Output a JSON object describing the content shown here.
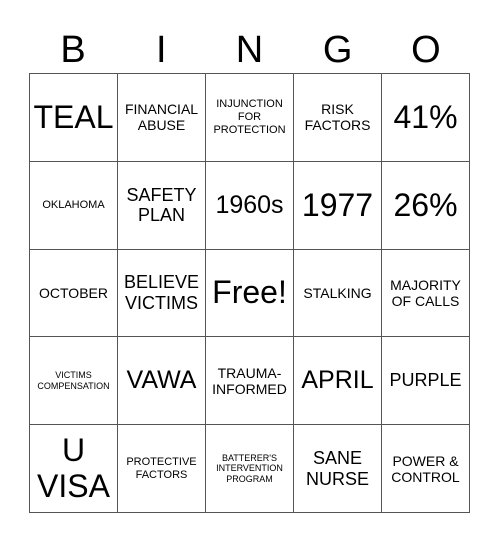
{
  "header": [
    "B",
    "I",
    "N",
    "G",
    "O"
  ],
  "cells": [
    [
      {
        "text": "TEAL",
        "size": "xl"
      },
      {
        "text": "FINANCIAL ABUSE",
        "size": "sm"
      },
      {
        "text": "INJUNCTION FOR PROTECTION",
        "size": "xs"
      },
      {
        "text": "RISK FACTORS",
        "size": "sm"
      },
      {
        "text": "41%",
        "size": "xl"
      }
    ],
    [
      {
        "text": "OKLAHOMA",
        "size": "xs"
      },
      {
        "text": "SAFETY PLAN",
        "size": "md"
      },
      {
        "text": "1960s",
        "size": "lg"
      },
      {
        "text": "1977",
        "size": "xl"
      },
      {
        "text": "26%",
        "size": "xl"
      }
    ],
    [
      {
        "text": "OCTOBER",
        "size": "sm"
      },
      {
        "text": "BELIEVE VICTIMS",
        "size": "md"
      },
      {
        "text": "Free!",
        "size": "xl"
      },
      {
        "text": "STALKING",
        "size": "sm"
      },
      {
        "text": "MAJORITY OF CALLS",
        "size": "sm"
      }
    ],
    [
      {
        "text": "VICTIMS COMPENSATION",
        "size": "xxs"
      },
      {
        "text": "VAWA",
        "size": "lg"
      },
      {
        "text": "TRAUMA-INFORMED",
        "size": "sm"
      },
      {
        "text": "APRIL",
        "size": "lg"
      },
      {
        "text": "PURPLE",
        "size": "md"
      }
    ],
    [
      {
        "text": "U VISA",
        "size": "xl"
      },
      {
        "text": "PROTECTIVE FACTORS",
        "size": "xs"
      },
      {
        "text": "BATTERER'S INTERVENTION PROGRAM",
        "size": "xxs"
      },
      {
        "text": "SANE NURSE",
        "size": "md"
      },
      {
        "text": "POWER & CONTROL",
        "size": "sm"
      }
    ]
  ]
}
